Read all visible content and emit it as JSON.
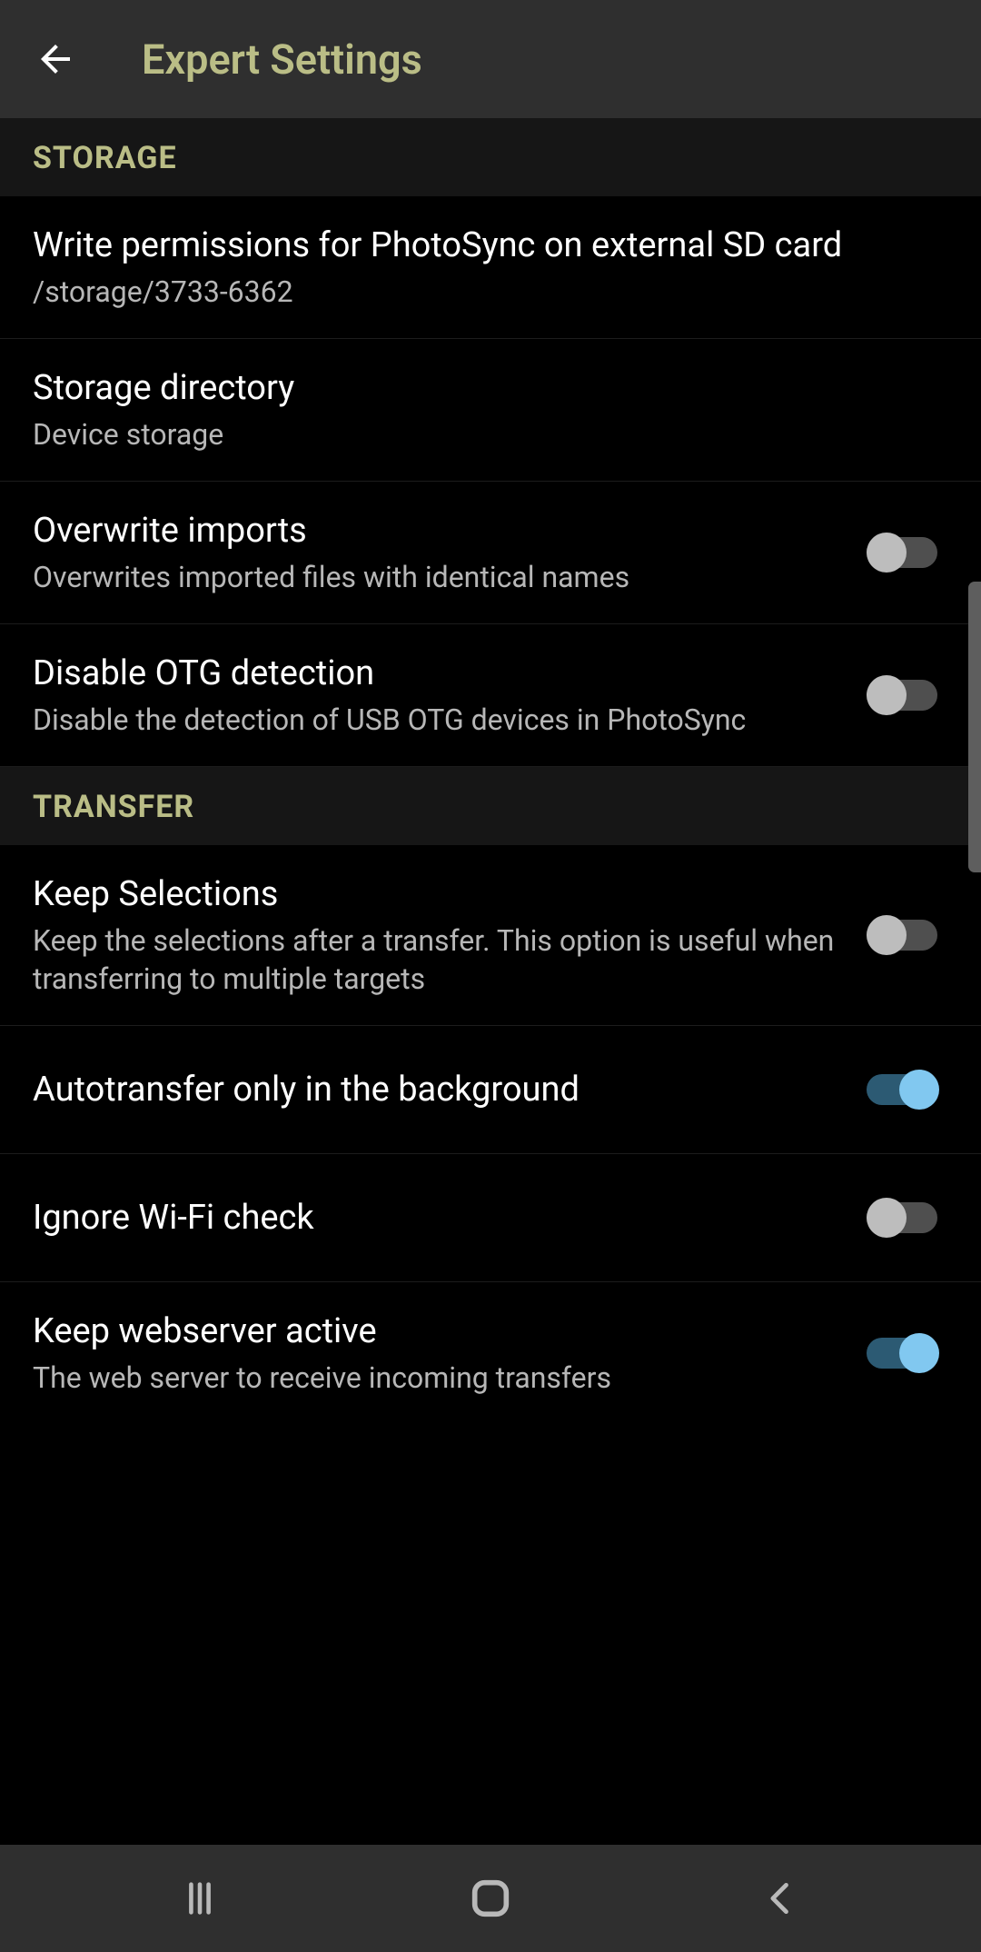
{
  "header": {
    "title": "Expert Settings"
  },
  "icons": {
    "back": "arrow-left",
    "recent": "recent-apps",
    "home": "home",
    "nav_back": "back"
  },
  "sections": [
    {
      "id": "storage",
      "label": "STORAGE",
      "items": [
        {
          "id": "write-permissions",
          "title": "Write permissions for PhotoSync on external SD card",
          "subtitle": "/storage/3733-6362",
          "type": "link"
        },
        {
          "id": "storage-directory",
          "title": "Storage directory",
          "subtitle": "Device storage",
          "type": "link"
        },
        {
          "id": "overwrite-imports",
          "title": "Overwrite imports",
          "subtitle": "Overwrites imported files with identical names",
          "type": "switch",
          "value": false
        },
        {
          "id": "disable-otg",
          "title": "Disable OTG detection",
          "subtitle": "Disable the detection of USB OTG devices in PhotoSync",
          "type": "switch",
          "value": false
        }
      ]
    },
    {
      "id": "transfer",
      "label": "TRANSFER",
      "items": [
        {
          "id": "keep-selections",
          "title": "Keep Selections",
          "subtitle": "Keep the selections after a transfer. This option is useful when transferring to multiple targets",
          "type": "switch",
          "value": false
        },
        {
          "id": "autotransfer-bg",
          "title": "Autotransfer only in the background",
          "subtitle": "",
          "type": "switch",
          "value": true
        },
        {
          "id": "ignore-wifi",
          "title": "Ignore Wi-Fi check",
          "subtitle": "",
          "type": "switch",
          "value": false
        },
        {
          "id": "keep-webserver",
          "title": "Keep webserver active",
          "subtitle": "The web server to receive incoming transfers",
          "type": "switch",
          "value": true
        }
      ]
    }
  ],
  "colors": {
    "accent": "#babd86",
    "switch_on_thumb": "#81c8f0",
    "switch_on_track": "#2c5a73"
  }
}
